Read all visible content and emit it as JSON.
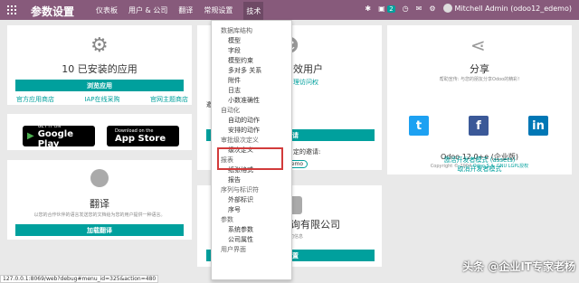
{
  "navbar": {
    "title": "参数设置",
    "menu": [
      "仪表板",
      "用户 & 公司",
      "翻译",
      "常规设置",
      "技术"
    ],
    "chat_count": "2",
    "user": "Mitchell Admin (odoo12_edemo)"
  },
  "apps_card": {
    "title": "10 已安装的应用",
    "button": "浏览应用",
    "links": [
      "官方应用商店",
      "IAP在线采购",
      "官网主题商店"
    ]
  },
  "users_card": {
    "title_suffix": "效用户",
    "link_suffix": "理访问权",
    "invite_label_frag": "邀",
    "button_frag": "邀请",
    "pending_frag": "定的邀请:",
    "demo_chip": "demo"
  },
  "stores": {
    "google_small": "GET IT ON",
    "google_big": "Google Play",
    "apple_small": "Download on the",
    "apple_big": "App Store"
  },
  "translate_card": {
    "title": "翻译",
    "desc": "以您的合作伙伴的语言发送您的文档给为您的用户提供一种语言。",
    "button": "加载翻译"
  },
  "company_card": {
    "title_suffix": "咨询有限公司",
    "sub_frag": "的公司信息",
    "button_frag": "设置"
  },
  "share_card": {
    "title": "分享",
    "desc": "帮助宣传: 与您的朋友分享Odoo的精彩!",
    "version": "Odoo 12.0+e (企业版)",
    "copyright": "Copyright © 2004",
    "copyright_link1": "Odoo S.A.",
    "copyright_link2": "GNU LGPL授权",
    "dev_links": [
      "激活开发者模式 (assets)",
      "取消开发者模式"
    ]
  },
  "dropdown": {
    "items": [
      {
        "label": "数据库结构",
        "type": "header"
      },
      {
        "label": "模型",
        "type": "item"
      },
      {
        "label": "字段",
        "type": "item"
      },
      {
        "label": "模型约束",
        "type": "item"
      },
      {
        "label": "多对多 关系",
        "type": "item"
      },
      {
        "label": "附件",
        "type": "item"
      },
      {
        "label": "日志",
        "type": "item"
      },
      {
        "label": "小数准确性",
        "type": "item"
      },
      {
        "label": "自动化",
        "type": "header"
      },
      {
        "label": "自动的动作",
        "type": "item"
      },
      {
        "label": "安排的动作",
        "type": "item"
      },
      {
        "label": "审批级次定义",
        "type": "header"
      },
      {
        "label": "级次定义",
        "type": "item"
      },
      {
        "label": "报表",
        "type": "header"
      },
      {
        "label": "纸张格式",
        "type": "item"
      },
      {
        "label": "报告",
        "type": "item"
      },
      {
        "label": "序列与标识符",
        "type": "header"
      },
      {
        "label": "外部标识",
        "type": "item"
      },
      {
        "label": "序号",
        "type": "item"
      },
      {
        "label": "参数",
        "type": "header"
      },
      {
        "label": "系统参数",
        "type": "item"
      },
      {
        "label": "公司属性",
        "type": "item"
      },
      {
        "label": "用户界面",
        "type": "header"
      }
    ]
  },
  "status_url": "127.0.0.1:8069/web?debug#menu_id=325&action=480",
  "watermark": "头条 @企业IT专家老杨",
  "colors": {
    "brand": "#875a7b",
    "accent": "#00a09d"
  }
}
